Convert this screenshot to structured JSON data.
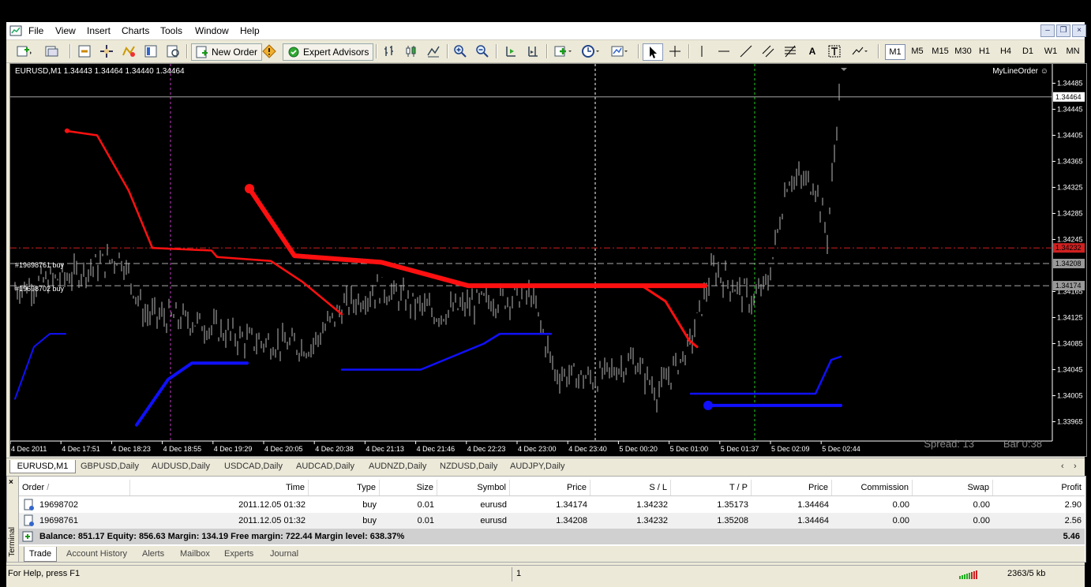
{
  "menu": [
    "File",
    "View",
    "Insert",
    "Charts",
    "Tools",
    "Window",
    "Help"
  ],
  "toolbar": {
    "new_order": "New Order",
    "expert_advisors": "Expert Advisors",
    "timeframes": [
      "M1",
      "M5",
      "M15",
      "M30",
      "H1",
      "H4",
      "D1",
      "W1",
      "MN"
    ],
    "active_timeframe": "M1"
  },
  "chart": {
    "title": "EURUSD,M1  1.34443 1.34464 1.34440 1.34464",
    "ea_name": "MyLineOrder ☺",
    "order_labels": [
      "#19698761 buy",
      "#19698702 buy"
    ],
    "price_ticks": [
      "1.34485",
      "1.34445",
      "1.34405",
      "1.34365",
      "1.34325",
      "1.34285",
      "1.34245",
      "1.34165",
      "1.34125",
      "1.34085",
      "1.34045",
      "1.34005",
      "1.33965"
    ],
    "price_markers": {
      "current": "1.34464",
      "red": "1.34232",
      "line1": "1.34208",
      "line2": "1.34174"
    },
    "time_ticks": [
      "4 Dec 2011",
      "4 Dec 17:51",
      "4 Dec 18:23",
      "4 Dec 18:55",
      "4 Dec 19:29",
      "4 Dec 20:05",
      "4 Dec 20:38",
      "4 Dec 21:13",
      "4 Dec 21:46",
      "4 Dec 22:23",
      "4 Dec 23:00",
      "4 Dec 23:40",
      "5 Dec 00:20",
      "5 Dec 01:00",
      "5 Dec 01:37",
      "5 Dec 02:09",
      "5 Dec 02:44"
    ],
    "spread": "Spread: 13",
    "bar": "Bar  0:38",
    "colors": {
      "bg": "#000000",
      "up_line": "#ff0000",
      "down_line": "#0000ff",
      "candle": "#c0c0c0"
    }
  },
  "chart_tabs": [
    "EURUSD,M1",
    "GBPUSD,Daily",
    "AUDUSD,Daily",
    "USDCAD,Daily",
    "AUDCAD,Daily",
    "AUDNZD,Daily",
    "NZDUSD,Daily",
    "AUDJPY,Daily"
  ],
  "terminal": {
    "side_label": "Terminal",
    "close": "×",
    "headers": [
      "Order",
      "Time",
      "Type",
      "Size",
      "Symbol",
      "Price",
      "S / L",
      "T / P",
      "Price",
      "Commission",
      "Swap",
      "Profit"
    ],
    "rows": [
      [
        "19698702",
        "2011.12.05 01:32",
        "buy",
        "0.01",
        "eurusd",
        "1.34174",
        "1.34232",
        "1.35173",
        "1.34464",
        "0.00",
        "0.00",
        "2.90"
      ],
      [
        "19698761",
        "2011.12.05 01:32",
        "buy",
        "0.01",
        "eurusd",
        "1.34208",
        "1.34232",
        "1.35208",
        "1.34464",
        "0.00",
        "0.00",
        "2.56"
      ]
    ],
    "balance": "Balance: 851.17  Equity: 856.63  Margin: 134.19  Free margin: 722.44  Margin level: 638.37%",
    "total_profit": "5.46",
    "tabs": [
      "Trade",
      "Account History",
      "Alerts",
      "Mailbox",
      "Experts",
      "Journal"
    ]
  },
  "status": {
    "help": "For Help, press F1",
    "page": "1",
    "traffic": "2363/5 kb"
  }
}
